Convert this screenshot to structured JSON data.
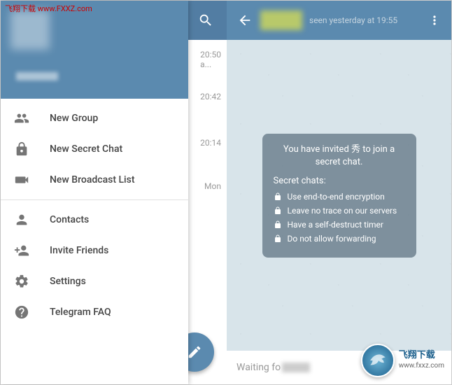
{
  "watermark": {
    "top_text": "飞翔下载 www.FXXZ.com",
    "logo_title": "飞翔下载",
    "logo_sub": "www.fxxz.com"
  },
  "left": {
    "chat_times": {
      "r1": "20:50",
      "r1b": "a...",
      "r2": "20:42",
      "r3": "20:14",
      "r4": "Mon"
    },
    "drawer": {
      "items": [
        {
          "label": "New Group"
        },
        {
          "label": "New Secret Chat"
        },
        {
          "label": "New Broadcast List"
        }
      ],
      "items2": [
        {
          "label": "Contacts"
        },
        {
          "label": "Invite Friends"
        },
        {
          "label": "Settings"
        },
        {
          "label": "Telegram FAQ"
        }
      ]
    }
  },
  "right": {
    "header_status": "seen yesterday at 19:55",
    "secret": {
      "invite": "You have invited 秀 to join a secret chat.",
      "title": "Secret chats:",
      "items": [
        "Use end-to-end encryption",
        "Leave no trace on our servers",
        "Have a self-destruct timer",
        "Do not allow forwarding"
      ]
    },
    "input_prefix": "Waiting fo"
  }
}
